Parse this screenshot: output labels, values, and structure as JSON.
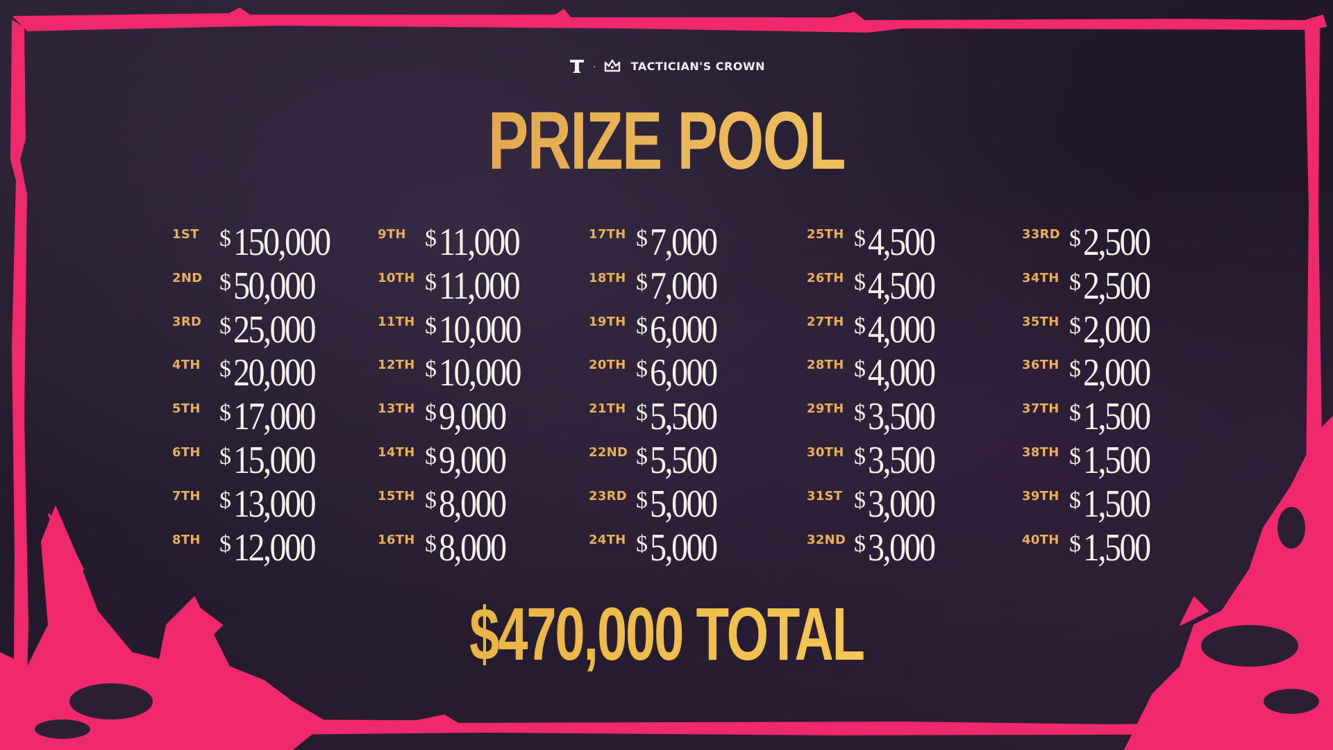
{
  "brand": {
    "name": "TACTICIAN'S CROWN",
    "separator": "·",
    "logo_icon": "tft-logo-icon",
    "crown_icon": "crown-icon"
  },
  "title": "PRIZE POOL",
  "currency_symbol": "$",
  "prizes": [
    {
      "place": "1ST",
      "amount": "150,000"
    },
    {
      "place": "2ND",
      "amount": "50,000"
    },
    {
      "place": "3RD",
      "amount": "25,000"
    },
    {
      "place": "4TH",
      "amount": "20,000"
    },
    {
      "place": "5TH",
      "amount": "17,000"
    },
    {
      "place": "6TH",
      "amount": "15,000"
    },
    {
      "place": "7TH",
      "amount": "13,000"
    },
    {
      "place": "8TH",
      "amount": "12,000"
    },
    {
      "place": "9TH",
      "amount": "11,000"
    },
    {
      "place": "10TH",
      "amount": "11,000"
    },
    {
      "place": "11TH",
      "amount": "10,000"
    },
    {
      "place": "12TH",
      "amount": "10,000"
    },
    {
      "place": "13TH",
      "amount": "9,000"
    },
    {
      "place": "14TH",
      "amount": "9,000"
    },
    {
      "place": "15TH",
      "amount": "8,000"
    },
    {
      "place": "16TH",
      "amount": "8,000"
    },
    {
      "place": "17TH",
      "amount": "7,000"
    },
    {
      "place": "18TH",
      "amount": "7,000"
    },
    {
      "place": "19TH",
      "amount": "6,000"
    },
    {
      "place": "20TH",
      "amount": "6,000"
    },
    {
      "place": "21TH",
      "amount": "5,500"
    },
    {
      "place": "22ND",
      "amount": "5,500"
    },
    {
      "place": "23RD",
      "amount": "5,000"
    },
    {
      "place": "24TH",
      "amount": "5,000"
    },
    {
      "place": "25TH",
      "amount": "4,500"
    },
    {
      "place": "26TH",
      "amount": "4,500"
    },
    {
      "place": "27TH",
      "amount": "4,000"
    },
    {
      "place": "28TH",
      "amount": "4,000"
    },
    {
      "place": "29TH",
      "amount": "3,500"
    },
    {
      "place": "30TH",
      "amount": "3,500"
    },
    {
      "place": "31ST",
      "amount": "3,000"
    },
    {
      "place": "32ND",
      "amount": "3,000"
    },
    {
      "place": "33RD",
      "amount": "2,500"
    },
    {
      "place": "34TH",
      "amount": "2,500"
    },
    {
      "place": "35TH",
      "amount": "2,000"
    },
    {
      "place": "36TH",
      "amount": "2,000"
    },
    {
      "place": "37TH",
      "amount": "1,500"
    },
    {
      "place": "38TH",
      "amount": "1,500"
    },
    {
      "place": "39TH",
      "amount": "1,500"
    },
    {
      "place": "40TH",
      "amount": "1,500"
    }
  ],
  "total": "$470,000 TOTAL",
  "colors": {
    "accent_pink": "#f0286c",
    "gold": "#f2c24f",
    "place_gold": "#e8b05a",
    "amount_text": "#f4f0ea",
    "background": "#221a2c"
  }
}
